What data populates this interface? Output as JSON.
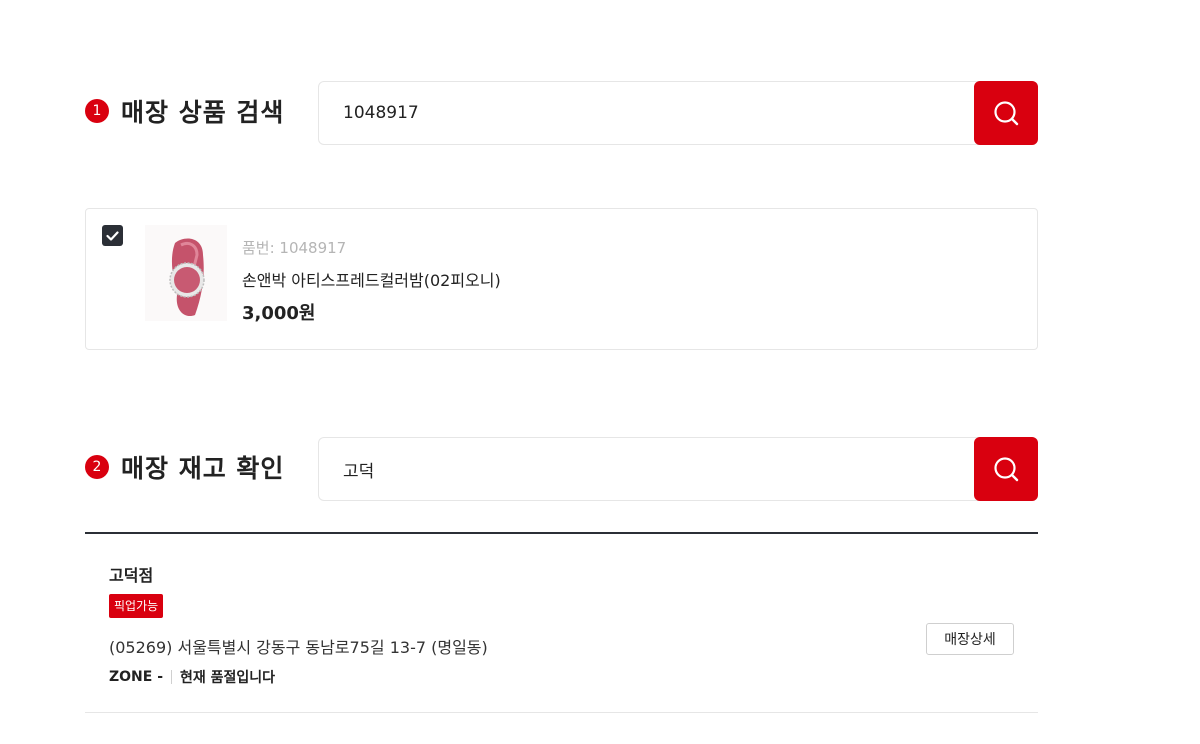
{
  "section1": {
    "number": "1",
    "title": "매장 상품 검색",
    "search_value": "1048917",
    "search_button_icon": "search-icon"
  },
  "product": {
    "checked": true,
    "code_text": "품번: 1048917",
    "name": "손앤박 아티스프레드컬러밤(02피오니)",
    "price": "3,000원"
  },
  "section2": {
    "number": "2",
    "title": "매장 재고 확인",
    "search_value": "고덕",
    "search_button_icon": "search-icon"
  },
  "store": {
    "name": "고덕점",
    "badge": "픽업가능",
    "address": "(05269) 서울특별시 강동구 동남로75길 13-7 (명일동)",
    "zone": "ZONE -",
    "stock_status": "현재 품절입니다",
    "detail_button": "매장상세"
  },
  "colors": {
    "accent": "#d9000f",
    "dark": "#2b2f36",
    "border": "#e6e6e6"
  }
}
